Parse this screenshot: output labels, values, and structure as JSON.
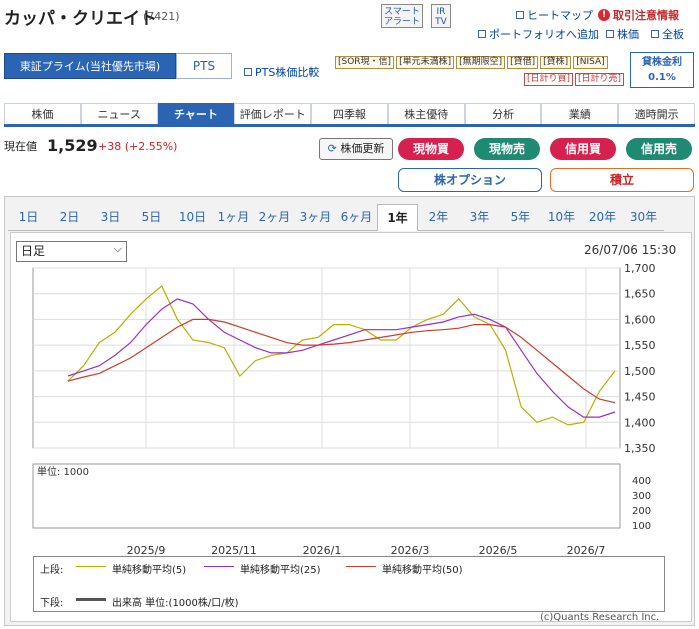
{
  "header": {
    "title": "カッパ・クリエイト",
    "code": "(7421)",
    "smart_alert": "スマート アラート",
    "ir_tv": "IR TV",
    "heatmap": "ヒートマップ",
    "caution": "取引注意情報",
    "portfolio": "ポートフォリオへ追加",
    "stock_price": "株価",
    "all_board": "全板"
  },
  "market": {
    "selected": "東証プライム(当社優先市場)",
    "pts": "PTS",
    "pts_compare": "PTS株価比較"
  },
  "badges": [
    "[SOR現・信]",
    "[単元未満株]",
    "[無期限空]",
    "[貸借]",
    "[貸株]",
    "[NISA]",
    "[日計り買]",
    "[日計り売]"
  ],
  "lending": {
    "label": "貸株金利",
    "value": "0.1%"
  },
  "tabs": [
    "株価",
    "ニュース",
    "チャート",
    "評価レポート",
    "四季報",
    "株主優待",
    "分析",
    "業績",
    "適時開示"
  ],
  "quote": {
    "label": "現在値",
    "price": "1,529",
    "change": "+38 (+2.55%)",
    "update": "株価更新"
  },
  "orders": {
    "spot_buy": "現物買",
    "spot_sell": "現物売",
    "margin_buy": "信用買",
    "margin_sell": "信用売",
    "option": "株オプション",
    "tsumitate": "積立"
  },
  "periods": [
    "1日",
    "2日",
    "3日",
    "5日",
    "10日",
    "1ヶ月",
    "2ヶ月",
    "3ヶ月",
    "6ヶ月",
    "1年",
    "2年",
    "3年",
    "5年",
    "10年",
    "20年",
    "30年"
  ],
  "chart_controls": {
    "interval": "日足",
    "timestamp": "26/07/06 15:30"
  },
  "chart_data": {
    "type": "line",
    "price_axis": {
      "ylim": [
        1350,
        1700
      ],
      "ticks": [
        "1,700",
        "1,650",
        "1,600",
        "1,550",
        "1,500",
        "1,450",
        "1,400",
        "1,350"
      ]
    },
    "volume_axis": {
      "label": "単位: 1000",
      "ticks": [
        "400",
        "300",
        "200",
        "100"
      ]
    },
    "x_ticks": [
      "2025/9",
      "2025/11",
      "2026/1",
      "2026/3",
      "2026/5",
      "2026/7"
    ],
    "series": [
      {
        "name": "単純移動平均(5)",
        "color": "#b8b000",
        "values": [
          1480,
          1510,
          1555,
          1575,
          1610,
          1640,
          1665,
          1600,
          1560,
          1555,
          1545,
          1490,
          1520,
          1530,
          1535,
          1560,
          1565,
          1590,
          1590,
          1580,
          1560,
          1560,
          1585,
          1600,
          1610,
          1640,
          1605,
          1590,
          1540,
          1430,
          1400,
          1410,
          1395,
          1400,
          1460,
          1500
        ]
      },
      {
        "name": "単純移動平均(25)",
        "color": "#9a2fbf",
        "values": [
          1490,
          1500,
          1510,
          1530,
          1555,
          1590,
          1620,
          1640,
          1630,
          1600,
          1575,
          1560,
          1545,
          1535,
          1535,
          1540,
          1550,
          1560,
          1570,
          1580,
          1580,
          1580,
          1585,
          1590,
          1595,
          1605,
          1610,
          1600,
          1585,
          1540,
          1495,
          1460,
          1430,
          1410,
          1410,
          1420
        ]
      },
      {
        "name": "単純移動平均(50)",
        "color": "#d03a2a",
        "values": [
          1480,
          1488,
          1495,
          1510,
          1525,
          1545,
          1565,
          1585,
          1600,
          1600,
          1595,
          1585,
          1575,
          1565,
          1555,
          1550,
          1550,
          1552,
          1555,
          1560,
          1565,
          1570,
          1575,
          1578,
          1580,
          1583,
          1590,
          1590,
          1585,
          1565,
          1540,
          1515,
          1490,
          1465,
          1445,
          1438
        ]
      }
    ],
    "volume_label": "出来高 単位:(1000株/口/枚)",
    "legend_upper": "上段:",
    "legend_lower": "下段:"
  },
  "copyright": "(c)Quants Research Inc."
}
